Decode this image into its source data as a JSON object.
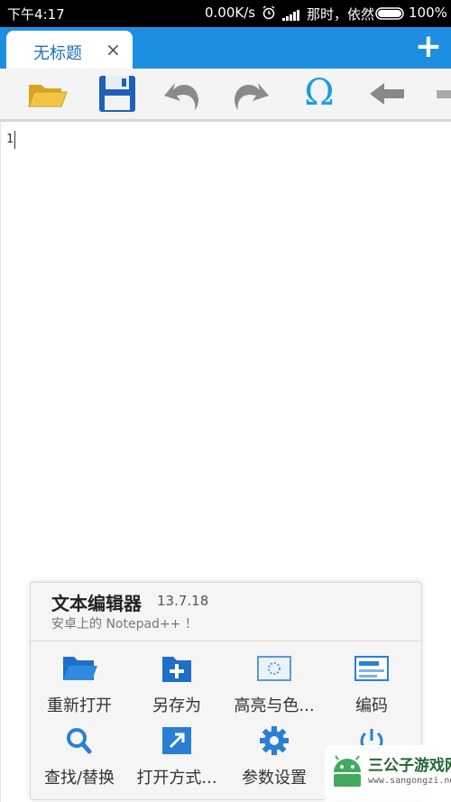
{
  "status_bar": {
    "time": "下午4:17",
    "net_speed": "0.00K/s",
    "carrier": "那时，依然",
    "battery": "100%"
  },
  "tab_bar": {
    "tabs": [
      {
        "label": "无标题",
        "close": "×"
      }
    ],
    "add_label": "+"
  },
  "toolbar": {
    "items": [
      "open-folder-icon",
      "save-icon",
      "undo-icon",
      "redo-icon",
      "special-char-icon",
      "back-arrow-icon",
      "more-icon"
    ],
    "special_char": "Ω"
  },
  "editor": {
    "line_numbers": [
      "1"
    ],
    "content": ""
  },
  "menu_panel": {
    "app_name": "文本编辑器",
    "version": "13.7.18",
    "tagline": "安卓上的 Notepad++ ！",
    "items": [
      {
        "label": "重新打开",
        "icon": "folder-open-icon"
      },
      {
        "label": "另存为",
        "icon": "folder-add-icon"
      },
      {
        "label": "高亮与色...",
        "icon": "highlight-icon"
      },
      {
        "label": "编码",
        "icon": "encoding-icon"
      },
      {
        "label": "查找/替换",
        "icon": "search-icon"
      },
      {
        "label": "打开方式...",
        "icon": "open-with-icon"
      },
      {
        "label": "参数设置",
        "icon": "gear-icon"
      },
      {
        "label": "",
        "icon": "power-icon"
      }
    ]
  },
  "watermark": {
    "title": "三公子游戏网",
    "url": "www.sangongzi.net"
  },
  "colors": {
    "accent": "#1e8fe0",
    "icon_blue": "#2a7fd4",
    "folder_yellow": "#f4c542",
    "toolbar_bg": "#f4f4f4"
  }
}
